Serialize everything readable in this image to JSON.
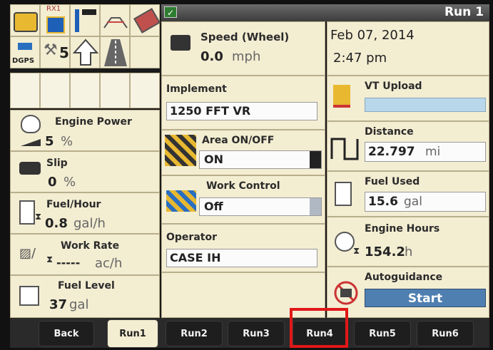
{
  "header": {
    "title": "Run 1"
  },
  "toolbar": {
    "rx_label": "RX1",
    "dgps_label": "DGPS",
    "satellite_count": "5"
  },
  "left": {
    "engine_power": {
      "label": "Engine Power",
      "value": "5",
      "unit": "%"
    },
    "slip": {
      "label": "Slip",
      "value": "0",
      "unit": "%"
    },
    "fuel_hour": {
      "label": "Fuel/Hour",
      "value": "0.8",
      "unit": "gal/h"
    },
    "work_rate": {
      "label": "Work Rate",
      "value": "-----",
      "unit": "ac/h"
    },
    "fuel_level": {
      "label": "Fuel Level",
      "value": "37",
      "unit": "gal"
    }
  },
  "middle": {
    "speed": {
      "label": "Speed (Wheel)",
      "value": "0.0",
      "unit": "mph"
    },
    "implement": {
      "label": "Implement",
      "value": "1250 FFT VR"
    },
    "area": {
      "label": "Area ON/OFF",
      "value": "ON"
    },
    "work_control": {
      "label": "Work Control",
      "value": "Off"
    },
    "operator": {
      "label": "Operator",
      "value": "CASE IH"
    }
  },
  "right": {
    "date": "Feb 07, 2014",
    "time": "2:47 pm",
    "vt_upload": {
      "label": "VT Upload",
      "progress": 0
    },
    "distance": {
      "label": "Distance",
      "value": "22.797",
      "unit": "mi"
    },
    "fuel_used": {
      "label": "Fuel Used",
      "value": "15.6",
      "unit": "gal"
    },
    "engine_hours": {
      "label": "Engine Hours",
      "value": "154.2",
      "unit": "h"
    },
    "autoguidance": {
      "label": "Autoguidance",
      "button": "Start"
    }
  },
  "tabs": [
    "Back",
    "Run1",
    "Run2",
    "Run3",
    "Run4",
    "Run5",
    "Run6"
  ],
  "colors": {
    "highlight": "#e01818",
    "accent_blue": "#b9d7ea",
    "panel": "#f3edd2"
  }
}
